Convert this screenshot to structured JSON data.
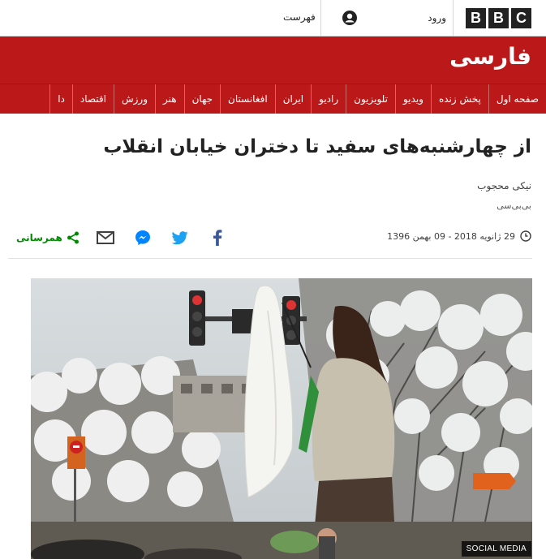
{
  "header": {
    "logo_letters": [
      "B",
      "B",
      "C"
    ],
    "login_label": "ورود",
    "menu_label": "فهرست"
  },
  "brand": {
    "name": "فارسی",
    "color": "#bb1919"
  },
  "nav": {
    "items": [
      "صفحه اول",
      "پخش زنده",
      "ویدیو",
      "تلویزیون",
      "رادیو",
      "ایران",
      "افغانستان",
      "جهان",
      "هنر",
      "ورزش",
      "اقتصاد",
      "دا"
    ]
  },
  "article": {
    "headline": "از چهارشنبه‌های سفید تا دختران خیابان انقلاب",
    "author": "نیکی محجوب",
    "source": "بی‌بی‌سی",
    "date": "29 ژانویه 2018 - 09 بهمن 1396",
    "share_label": "همرسانی",
    "share_icons": [
      "facebook-icon",
      "twitter-icon",
      "messenger-icon",
      "email-icon",
      "share-icon"
    ],
    "image_credit": "SOCIAL MEDIA"
  }
}
